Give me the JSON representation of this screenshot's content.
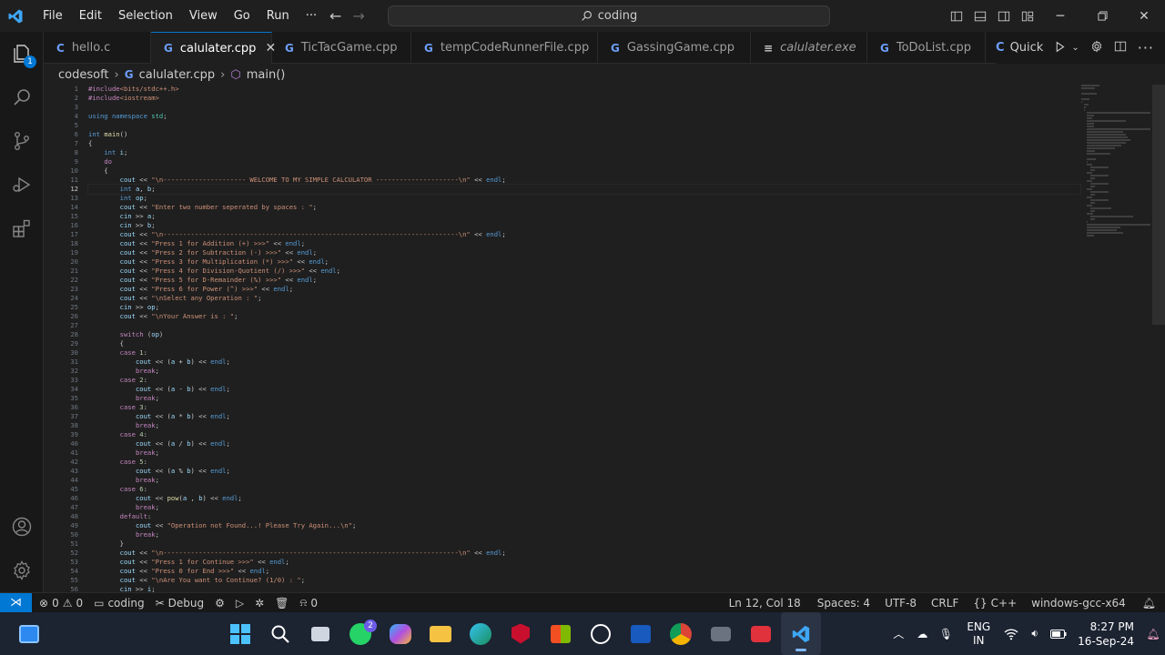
{
  "menu": [
    "File",
    "Edit",
    "Selection",
    "View",
    "Go",
    "Run",
    "···"
  ],
  "search": {
    "text": "coding"
  },
  "tabs": [
    {
      "label": "hello.c",
      "icon": "c-icon",
      "active": false
    },
    {
      "label": "calulater.cpp",
      "icon": "cpp-icon",
      "active": true
    },
    {
      "label": "TicTacGame.cpp",
      "icon": "cpp-icon",
      "active": false
    },
    {
      "label": "tempCodeRunnerFile.cpp",
      "icon": "cpp-icon",
      "active": false
    },
    {
      "label": "GassingGame.cpp",
      "icon": "cpp-icon",
      "active": false
    },
    {
      "label": "calulater.exe",
      "icon": "file-icon",
      "active": false
    },
    {
      "label": "ToDoList.cpp",
      "icon": "cpp-icon",
      "active": false
    }
  ],
  "tabs_right": {
    "quick_label": "Quick"
  },
  "breadcrumb": {
    "folder": "codesoft",
    "file": "calulater.cpp",
    "symbol": "main()"
  },
  "activity": {
    "explorer_badge": "1"
  },
  "editor": {
    "current_line": 12,
    "lines": [
      "#include<bits/stdc++.h>",
      "#include<iostream>",
      "",
      "using namespace std;",
      "",
      "int main()",
      "{",
      "    int i;",
      "    do",
      "    {",
      "        cout << \"\\n--------------------- WELCOME TO MY SIMPLE CALCULATOR ---------------------\\n\" << endl;",
      "        int a, b;",
      "        int op;",
      "        cout << \"Enter two number seperated by spaces : \";",
      "        cin >> a;",
      "        cin >> b;",
      "        cout << \"\\n---------------------------------------------------------------------------\\n\" << endl;",
      "        cout << \"Press 1 for Addition (+) >>>\" << endl;",
      "        cout << \"Press 2 for Subtraction (-) >>>\" << endl;",
      "        cout << \"Press 3 for Multiplication (*) >>>\" << endl;",
      "        cout << \"Press 4 for Division-Quotient (/) >>>\" << endl;",
      "        cout << \"Press 5 for D-Remainder (%) >>>\" << endl;",
      "        cout << \"Press 6 for Power (^) >>>\" << endl;",
      "        cout << \"\\nSelect any Operation : \";",
      "        cin >> op;",
      "        cout << \"\\nYour Answer is : \";",
      "",
      "        switch (op)",
      "        {",
      "        case 1:",
      "            cout << (a + b) << endl;",
      "            break;",
      "        case 2:",
      "            cout << (a - b) << endl;",
      "            break;",
      "        case 3:",
      "            cout << (a * b) << endl;",
      "            break;",
      "        case 4:",
      "            cout << (a / b) << endl;",
      "            break;",
      "        case 5:",
      "            cout << (a % b) << endl;",
      "            break;",
      "        case 6:",
      "            cout << pow(a , b) << endl;",
      "            break;",
      "        default:",
      "            cout << \"Operation not Found...! Please Try Again...\\n\";",
      "            break;",
      "        }",
      "        cout << \"\\n---------------------------------------------------------------------------\\n\" << endl;",
      "        cout << \"Press 1 for Continue >>>\" << endl;",
      "        cout << \"Press 0 for End >>>\" << endl;",
      "        cout << \"\\nAre You want to Continue? (1/0) : \";",
      "        cin >> i;"
    ]
  },
  "status": {
    "errors": "0",
    "warnings": "0",
    "folder": "coding",
    "debug": "Debug",
    "ports": "0",
    "cursor": "Ln 12, Col 18",
    "spaces": "Spaces: 4",
    "encoding": "UTF-8",
    "eol": "CRLF",
    "language": "C++",
    "config": "windows-gcc-x64"
  },
  "taskbar": {
    "whatsapp_badge": "2",
    "lang_top": "ENG",
    "lang_bottom": "IN",
    "time": "8:27 PM",
    "date": "16-Sep-24"
  },
  "colors": {
    "accent": "#0078d4",
    "keyword": "#569cd6",
    "control": "#c586c0",
    "string": "#ce9178",
    "number": "#b5cea8",
    "function": "#dcdcaa",
    "variable": "#9cdcfe",
    "type": "#4ec9b0"
  }
}
